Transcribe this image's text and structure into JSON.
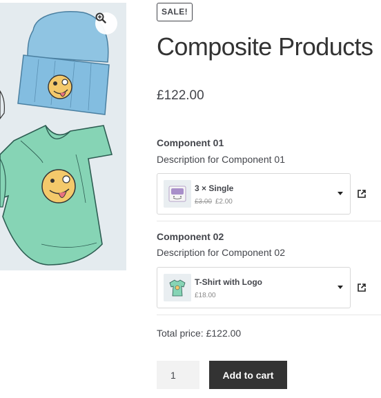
{
  "gallery": {
    "image": "product-image",
    "zoom_icon": "zoom-in-icon"
  },
  "product": {
    "badge": "SALE!",
    "title": "Composite Products",
    "price": "£122.00"
  },
  "components": [
    {
      "title": "Component 01",
      "description": "Description for Component 01",
      "selected": {
        "name": "3 × Single",
        "regular_price": "£3.00",
        "sale_price": "£2.00",
        "thumb_icon": "woo-album-thumbnail"
      },
      "caret_icon": "chevron-down-icon",
      "link_icon": "external-link-icon"
    },
    {
      "title": "Component 02",
      "description": "Description for Component 02",
      "selected": {
        "name": "T-Shirt with Logo",
        "price": "£18.00",
        "thumb_icon": "tshirt-thumbnail"
      },
      "caret_icon": "chevron-down-icon",
      "link_icon": "external-link-icon"
    }
  ],
  "total_label": "Total price: £122.00",
  "quantity": "1",
  "add_to_cart_label": "Add to cart",
  "colors": {
    "accent": "#333333",
    "text": "#43454b"
  }
}
